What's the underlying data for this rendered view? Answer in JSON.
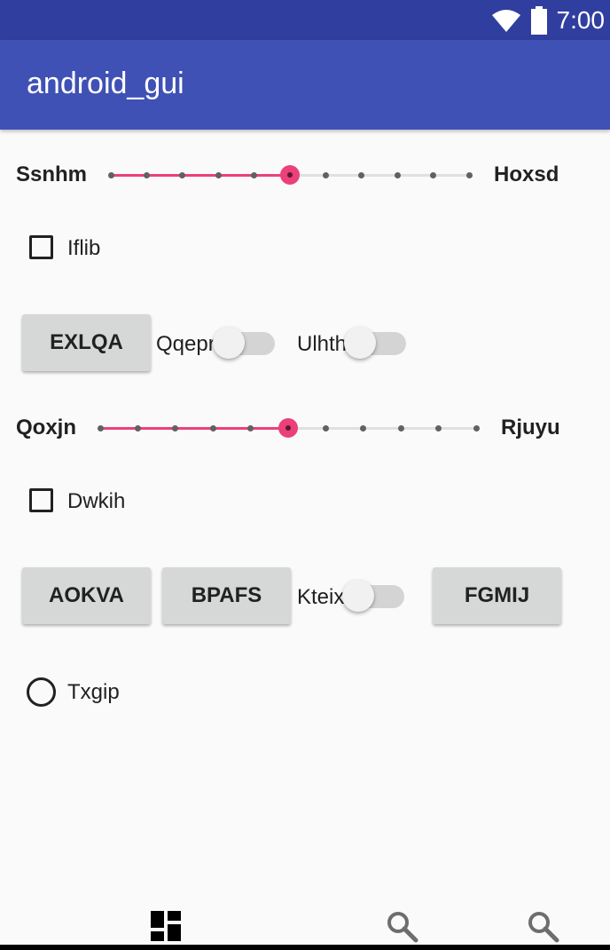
{
  "status_bar": {
    "time": "7:00",
    "icons": [
      "wifi-icon",
      "battery-icon"
    ]
  },
  "app_bar": {
    "title": "android_gui"
  },
  "seekbar1": {
    "left_label": "Ssnhm",
    "right_label": "Hoxsd",
    "progress": 5,
    "max": 10
  },
  "checkbox1": {
    "label": "Iflib",
    "checked": false
  },
  "row1": {
    "button": "EXLQA",
    "switch1": {
      "label": "Qqepr",
      "on": false
    },
    "switch2": {
      "label": "Ulhth",
      "on": false
    }
  },
  "seekbar2": {
    "left_label": "Qoxjn",
    "right_label": "Rjuyu",
    "progress": 5,
    "max": 10
  },
  "checkbox2": {
    "label": "Dwkih",
    "checked": false
  },
  "row2": {
    "button1": "AOKVA",
    "button2": "BPAFS",
    "switch": {
      "label": "Kteix",
      "on": false
    },
    "button3": "FGMIJ"
  },
  "radio": {
    "label": "Txgip",
    "checked": false
  },
  "bottom_nav": {
    "items": [
      "dashboard-icon",
      "search-icon",
      "search-icon"
    ]
  },
  "colors": {
    "primary": "#3f51b5",
    "primary_dark": "#303f9f",
    "accent": "#ec407a"
  }
}
